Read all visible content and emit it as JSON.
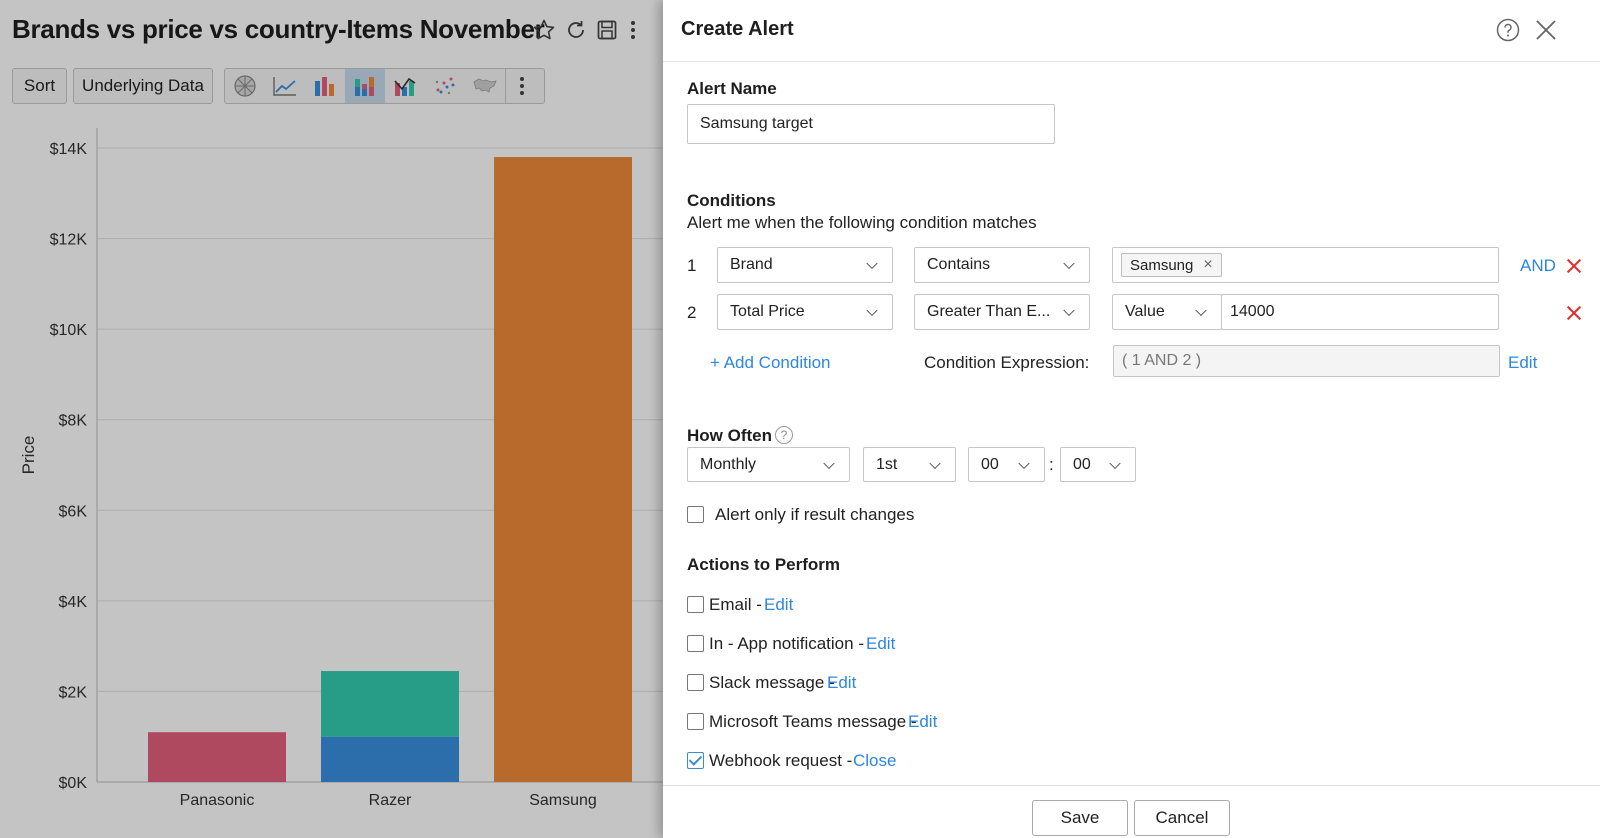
{
  "report": {
    "title": "Brands vs price vs country-Items November",
    "toolbar": {
      "sort_label": "Sort",
      "underlying_data_label": "Underlying Data"
    },
    "chart_type_icons": [
      "pie-chart-icon",
      "line-chart-icon",
      "bar-chart-icon",
      "stacked-bar-chart-icon",
      "combination-chart-icon",
      "scatter-chart-icon",
      "map-chart-icon"
    ],
    "active_chart_type": "stacked-bar-chart-icon"
  },
  "chart_data": {
    "type": "bar",
    "stacked": true,
    "categories": [
      "Panasonic",
      "Razer",
      "Samsung"
    ],
    "series": [
      {
        "color": "#e35f7d",
        "values": [
          1100,
          0,
          0
        ]
      },
      {
        "color": "#3a8fe0",
        "values": [
          0,
          1000,
          0
        ]
      },
      {
        "color": "#33ccb0",
        "values": [
          0,
          1450,
          0
        ]
      },
      {
        "color": "#f08a3a",
        "values": [
          0,
          0,
          13800
        ]
      }
    ],
    "ylabel": "Price",
    "yticks": [
      "$0K",
      "$2K",
      "$4K",
      "$6K",
      "$8K",
      "$10K",
      "$12K",
      "$14K"
    ],
    "ylim": [
      0,
      14500
    ],
    "grid": true
  },
  "alert": {
    "title": "Create Alert",
    "name_label": "Alert Name",
    "name_value": "Samsung target",
    "conditions_label": "Conditions",
    "conditions_hint": "Alert me when the following condition matches",
    "conditions": [
      {
        "num": "1",
        "field": "Brand",
        "operator": "Contains",
        "chip": "Samsung",
        "connector": "AND"
      },
      {
        "num": "2",
        "field": "Total Price",
        "operator": "Greater Than E...",
        "value_type": "Value",
        "value": "14000"
      }
    ],
    "add_condition": "+ Add Condition",
    "expression_label": "Condition Expression:",
    "expression_value": "( 1 AND 2 )",
    "expression_edit": "Edit",
    "how_often_label": "How Often",
    "frequency": "Monthly",
    "day": "1st",
    "hour": "00",
    "time_sep": ":",
    "minute": "00",
    "result_changes_label": "Alert only if result changes",
    "actions_label": "Actions to Perform",
    "actions": [
      {
        "label": "Email -",
        "link": "Edit",
        "checked": false
      },
      {
        "label": "In - App notification -",
        "link": "Edit",
        "checked": false
      },
      {
        "label": "Slack message -",
        "link": "Edit",
        "checked": false
      },
      {
        "label": "Microsoft Teams message -",
        "link": "Edit",
        "checked": false
      },
      {
        "label": "Webhook request -",
        "link": "Close",
        "checked": true
      }
    ],
    "save_label": "Save",
    "cancel_label": "Cancel"
  }
}
